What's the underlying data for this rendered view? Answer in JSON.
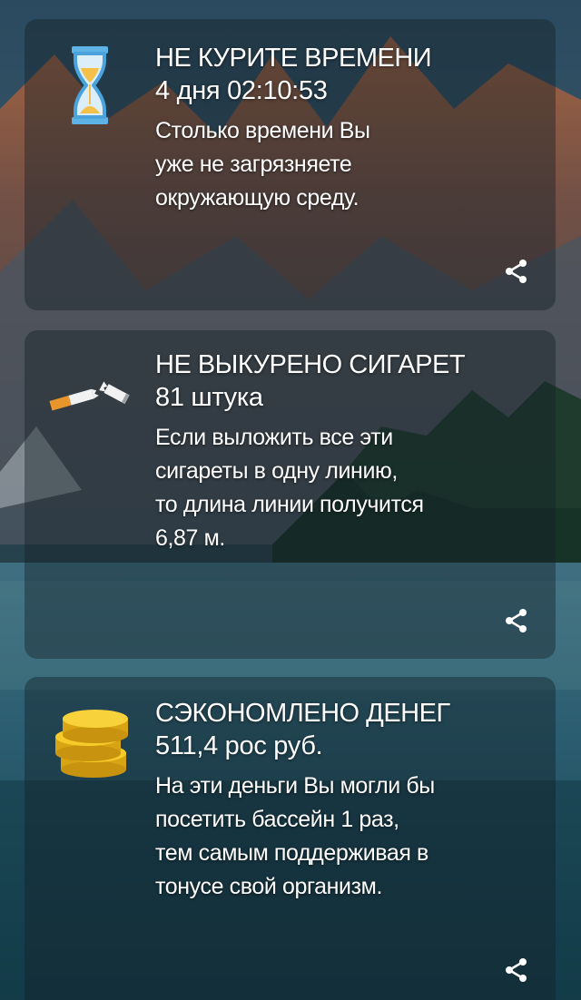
{
  "cards": [
    {
      "title": "НЕ КУРИТЕ ВРЕМЕНИ",
      "value": "4 дня 02:10:53",
      "description": "Столько времени Вы\nуже не загрязняете\nокружающую среду.",
      "icon": "hourglass-icon",
      "share_icon": "share-icon"
    },
    {
      "title": "НЕ ВЫКУРЕНО СИГАРЕТ",
      "value": "81 штука",
      "description": "Если выложить все эти\nсигареты в одну линию,\nто длина линии получится\n6,87 м.",
      "icon": "broken-cigarette-icon",
      "share_icon": "share-icon"
    },
    {
      "title": "СЭКОНОМЛЕНО ДЕНЕГ",
      "value": "511,4 рос руб.",
      "description": "На эти деньги Вы могли бы\nпосетить бассейн 1 раз,\nтем самым поддерживая в\nтонусе свой организм.",
      "icon": "coins-icon",
      "share_icon": "share-icon"
    }
  ],
  "colors": {
    "coin_gold": "#f2c21a",
    "hourglass_blue": "#4aa3dc",
    "sand": "#f3c04a"
  }
}
